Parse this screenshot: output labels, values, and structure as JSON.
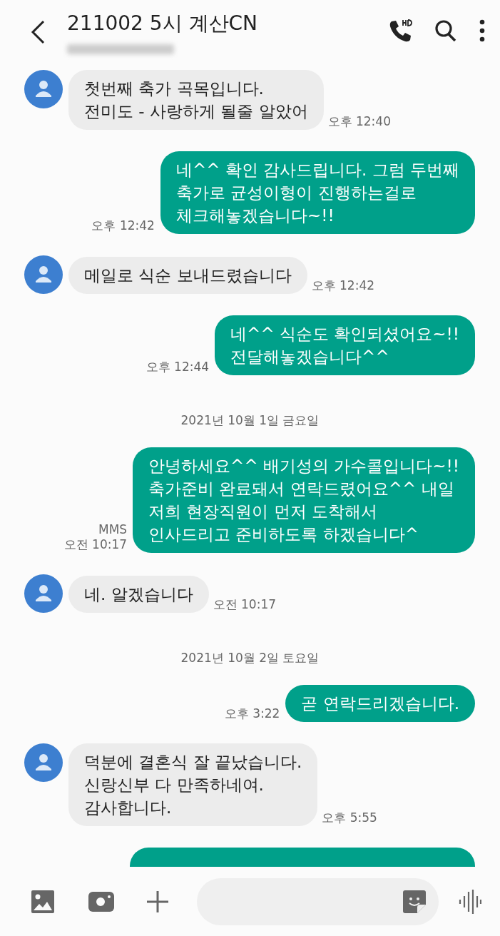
{
  "header": {
    "title": "211002 5시 계산CN"
  },
  "messages": [
    {
      "kind": "received",
      "lines": [
        "첫번째 축가 곡목입니다.",
        "전미도 - 사랑하게 될줄 알았어"
      ],
      "time": "오후 12:40"
    },
    {
      "kind": "sent",
      "lines": [
        "네^^ 확인 감사드립니다. 그럼 두번째",
        "축가로 균성이형이 진행하는걸로",
        "체크해놓겠습니다~!!"
      ],
      "time": "오후 12:42"
    },
    {
      "kind": "received",
      "lines": [
        "메일로 식순 보내드렸습니다"
      ],
      "time": "오후 12:42"
    },
    {
      "kind": "sent",
      "lines": [
        "네^^ 식순도 확인되셨어요~!!",
        "전달해놓겠습니다^^"
      ],
      "time": "오후 12:44"
    },
    {
      "kind": "date",
      "text": "2021년 10월 1일 금요일"
    },
    {
      "kind": "sent",
      "lines": [
        "안녕하세요^^ 배기성의 가수콜입니다~!!",
        "축가준비 완료돼서 연락드렸어요^^ 내일",
        "저희 현장직원이 먼저 도착해서",
        "인사드리고 준비하도록 하겠습니다^"
      ],
      "type_label": "MMS",
      "time": "오전 10:17"
    },
    {
      "kind": "received",
      "lines": [
        "네. 알겠습니다"
      ],
      "time": "오전 10:17"
    },
    {
      "kind": "date",
      "text": "2021년 10월 2일 토요일"
    },
    {
      "kind": "sent",
      "lines": [
        "곧 연락드리겠습니다."
      ],
      "time": "오후 3:22"
    },
    {
      "kind": "received",
      "lines": [
        "덕분에 결혼식 잘 끝났습니다.",
        "신랑신부 다  만족하네여.",
        "감사합니다."
      ],
      "time": "오후 5:55"
    },
    {
      "kind": "cut_off"
    }
  ]
}
